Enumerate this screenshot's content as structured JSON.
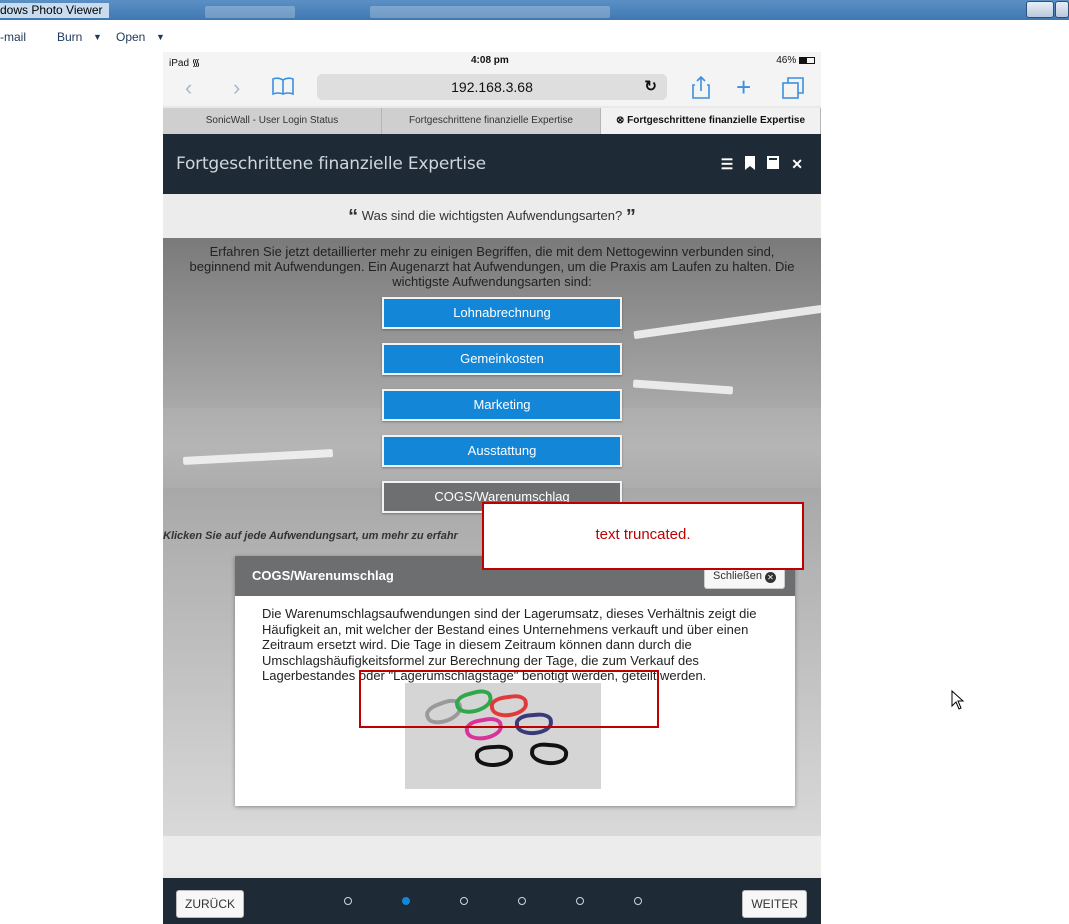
{
  "window": {
    "title": "dows Photo Viewer",
    "menu": {
      "email": "-mail",
      "burn": "Burn",
      "open": "Open"
    }
  },
  "status_bar": {
    "device": "iPad",
    "time": "4:08 pm",
    "battery": "46%"
  },
  "browser": {
    "url": "192.168.3.68",
    "tabs": [
      {
        "label": "SonicWall - User Login Status"
      },
      {
        "label": "Fortgeschrittene finanzielle Expertise"
      },
      {
        "label": "Fortgeschrittene finanzielle Expertise"
      }
    ]
  },
  "app": {
    "title": "Fortgeschrittene finanzielle Expertise",
    "question": "Was sind die wichtigsten Aufwendungsarten?",
    "intro": "Erfahren Sie jetzt detaillierter mehr zu einigen Begriffen, die mit dem Nettogewinn verbunden sind, beginnend mit Aufwendungen. Ein Augenarzt hat Aufwendungen, um die Praxis am Laufen zu halten. Die wichtigste Aufwendungsarten sind:",
    "choices": [
      {
        "label": "Lohnabrechnung"
      },
      {
        "label": "Gemeinkosten"
      },
      {
        "label": "Marketing"
      },
      {
        "label": "Ausstattung"
      },
      {
        "label": "COGS/Warenumschlag"
      }
    ],
    "hint": "Klicken Sie auf jede Aufwendungsart, um mehr zu erfahr",
    "panel": {
      "title": "COGS/Warenumschlag",
      "close_label": "Schließen",
      "body": "Die Warenumschlagsaufwendungen sind der Lagerumsatz, dieses Verhältnis zeigt die Häufigkeit an, mit welcher der Bestand eines Unternehmens verkauft und über einen Zeitraum ersetzt wird. Die Tage in diesem Zeitraum können dann durch die Umschlagshäufigkeitsformel zur Berechnung der Tage, die zum Verkauf des Lagerbestandes oder \"Lagerumschlagstage\" benötigt werden, geteilt werden."
    },
    "footer": {
      "back_label": "ZURÜCK",
      "next_label": "WEITER",
      "pages": 6,
      "current_page": 2
    }
  },
  "annotation": {
    "label": "text truncated."
  },
  "colors": {
    "accent": "#1386d8",
    "header": "#1e2a35",
    "annotation": "#c00000"
  }
}
